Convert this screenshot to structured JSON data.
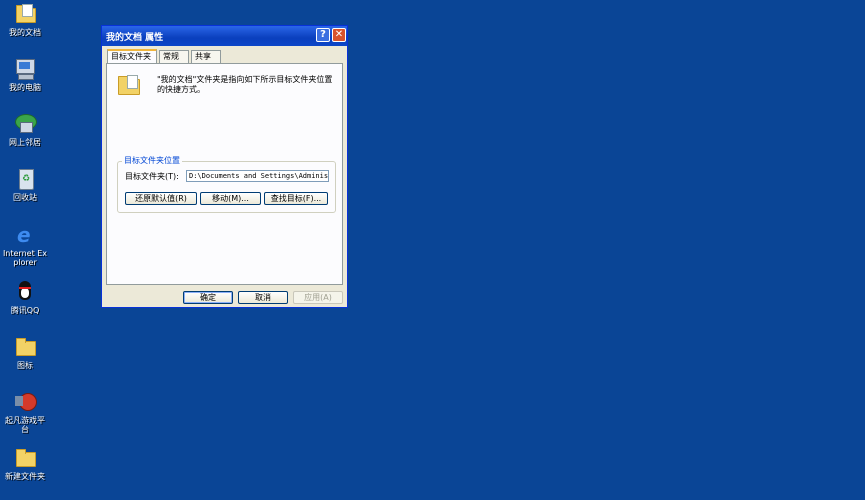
{
  "desktop": {
    "icons": [
      {
        "label": "我的文档",
        "icon": "my-documents-icon"
      },
      {
        "label": "我的电脑",
        "icon": "my-computer-icon"
      },
      {
        "label": "网上邻居",
        "icon": "network-places-icon"
      },
      {
        "label": "回收站",
        "icon": "recycle-bin-icon"
      },
      {
        "label": "Internet Explorer",
        "icon": "internet-explorer-icon"
      },
      {
        "label": "腾讯QQ",
        "icon": "qq-penguin-icon"
      },
      {
        "label": "图标",
        "icon": "folder-icon"
      },
      {
        "label": "起凡游戏平台",
        "icon": "game-platform-icon"
      },
      {
        "label": "新建文件夹",
        "icon": "folder-icon"
      }
    ],
    "background_color": "#0a4596"
  },
  "dialog": {
    "title": "我的文档 属性",
    "help_glyph": "?",
    "close_glyph": "✕",
    "tabs": [
      {
        "label": "目标文件夹",
        "active": true
      },
      {
        "label": "常规",
        "active": false
      },
      {
        "label": "共享",
        "active": false
      }
    ],
    "description": "\"我的文档\"文件夹是指向如下所示目标文件夹位置的快捷方式。",
    "group_title": "目标文件夹位置",
    "field_label": "目标文件夹(T):",
    "path_value": "D:\\Documents and Settings\\Administ",
    "buttons": {
      "restore": "还原默认值(R)",
      "move": "移动(M)...",
      "find_target": "查找目标(F)..."
    },
    "footer": {
      "ok": "确定",
      "cancel": "取消",
      "apply": "应用(A)"
    }
  }
}
